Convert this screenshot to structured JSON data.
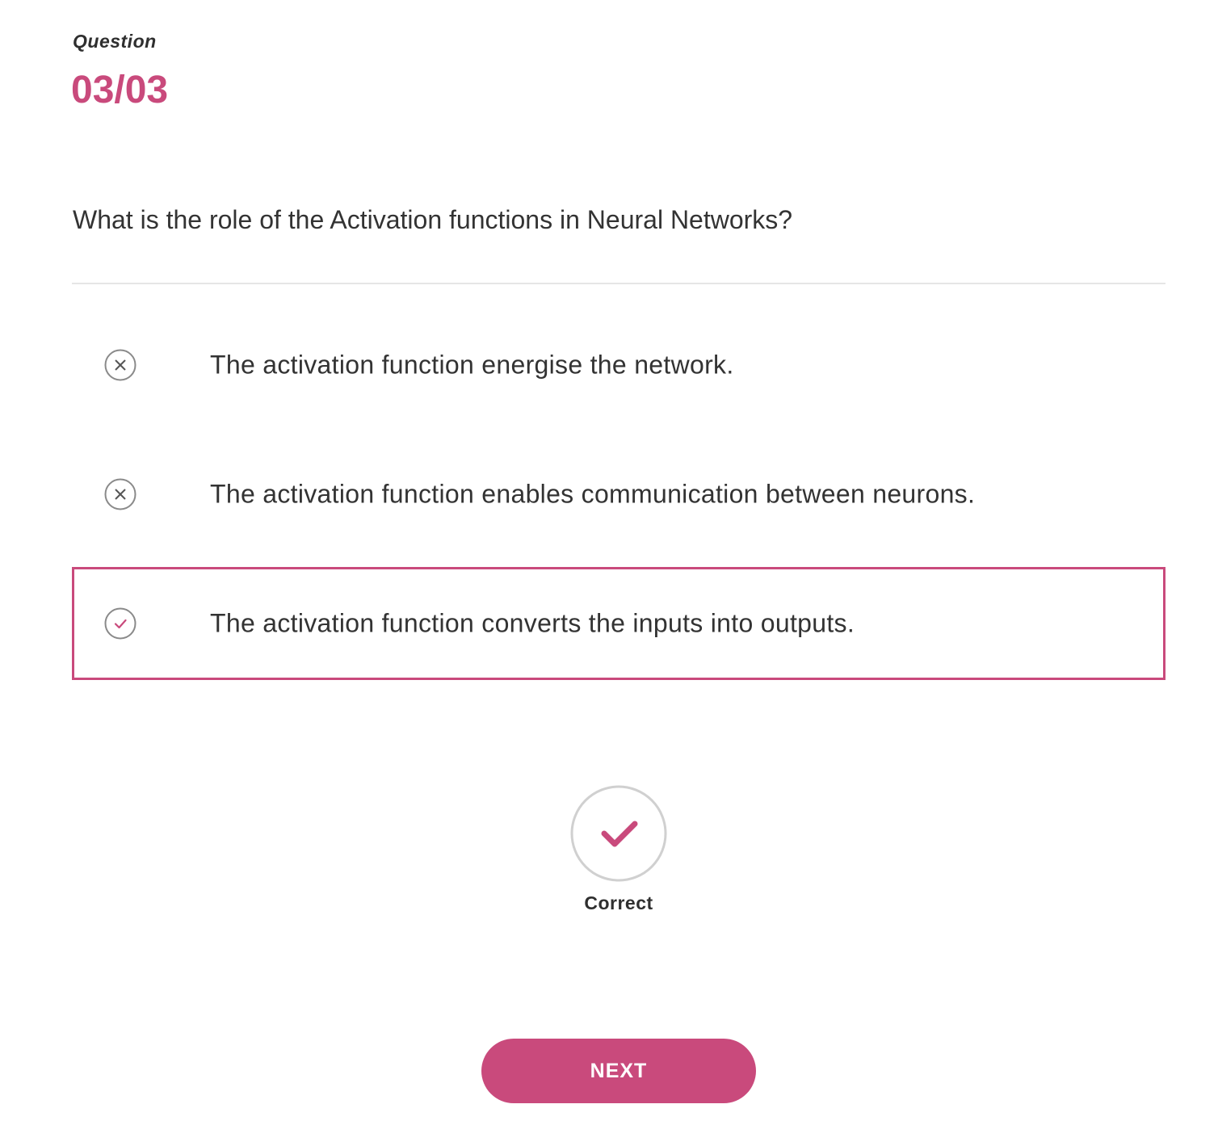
{
  "question": {
    "label": "Question",
    "counter": "03/03",
    "text": "What is the role of the Activation functions in Neural Networks?"
  },
  "options": [
    {
      "text": "The activation function energise the network.",
      "state": "incorrect",
      "icon": "x-circle-icon"
    },
    {
      "text": "The activation function enables communication between neurons.",
      "state": "incorrect",
      "icon": "x-circle-icon"
    },
    {
      "text": "The activation function converts the inputs into outputs.",
      "state": "correct-selected",
      "icon": "check-circle-icon"
    }
  ],
  "result": {
    "label": "Correct",
    "icon": "check-icon"
  },
  "next_button": {
    "label": "NEXT"
  },
  "colors": {
    "accent": "#c94a7c",
    "text": "#333333",
    "icon_gray": "#8a8a8a",
    "divider": "#e6e6e6"
  }
}
